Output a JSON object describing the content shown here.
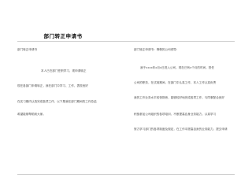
{
  "document": {
    "title": "部门转正申请书",
    "left_column": [
      "部门转正申请书",
      "本人已在部门任职学习，现申请转正",
      "现在各部门申请转正，我在部门中学习、工作，表现良好",
      "在实习期内认真完成各项工作，以下是我在部门期间的工作总结",
      "希望能够帮助到大家。"
    ],
    "right_column": [
      "部门转正申请书：尊敬的公司领导：",
      "我于xxxx年x月x日进入公司，现在已有x个月的时间，担任",
      "公司的职务，在试用期间，在部门中认真工作，本人工作认真负责",
      "我的工作业务水平较快熟悉，能够较好地完成各项工作，与同事配合良好",
      "积极参加公司组织的各项培训，不断提高自身业务能力，认真学习",
      "努力学习部门的各项制度及规定，在工作中提高自身的业务能力，提交申请"
    ]
  }
}
